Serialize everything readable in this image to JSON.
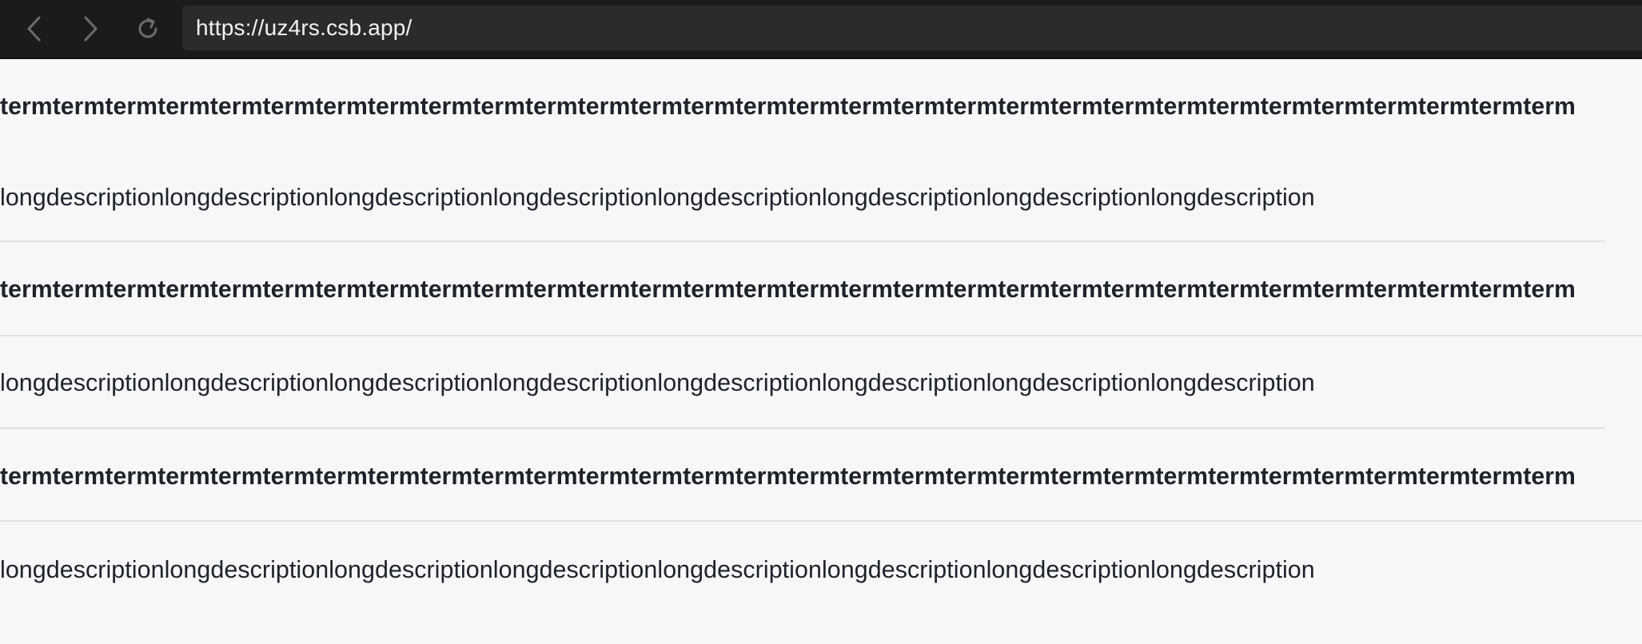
{
  "browser": {
    "url": "https://uz4rs.csb.app/",
    "back_icon": "chevron-left-icon",
    "forward_icon": "chevron-right-icon",
    "reload_icon": "reload-icon",
    "colors": {
      "toolbar": "#1b1b1b",
      "url_bar": "#2b2b2b",
      "icon": "#6b6b6b"
    }
  },
  "list": {
    "items": [
      {
        "term": "termtermtermtermtermtermtermtermtermtermtermtermtermtermtermtermtermtermtermtermtermtermtermtermtermtermtermtermtermterm",
        "description": "longdescriptionlongdescriptionlongdescriptionlongdescriptionlongdescriptionlongdescriptionlongdescriptionlongdescription"
      },
      {
        "term": "termtermtermtermtermtermtermtermtermtermtermtermtermtermtermtermtermtermtermtermtermtermtermtermtermtermtermtermtermterm",
        "description": "longdescriptionlongdescriptionlongdescriptionlongdescriptionlongdescriptionlongdescriptionlongdescriptionlongdescription"
      },
      {
        "term": "termtermtermtermtermtermtermtermtermtermtermtermtermtermtermtermtermtermtermtermtermtermtermtermtermtermtermtermtermterm",
        "description": "longdescriptionlongdescriptionlongdescriptionlongdescriptionlongdescriptionlongdescriptionlongdescriptionlongdescription"
      }
    ],
    "colors": {
      "background": "#f5f7f9",
      "text": "#1f2328",
      "divider": "#dfe2e5"
    }
  }
}
